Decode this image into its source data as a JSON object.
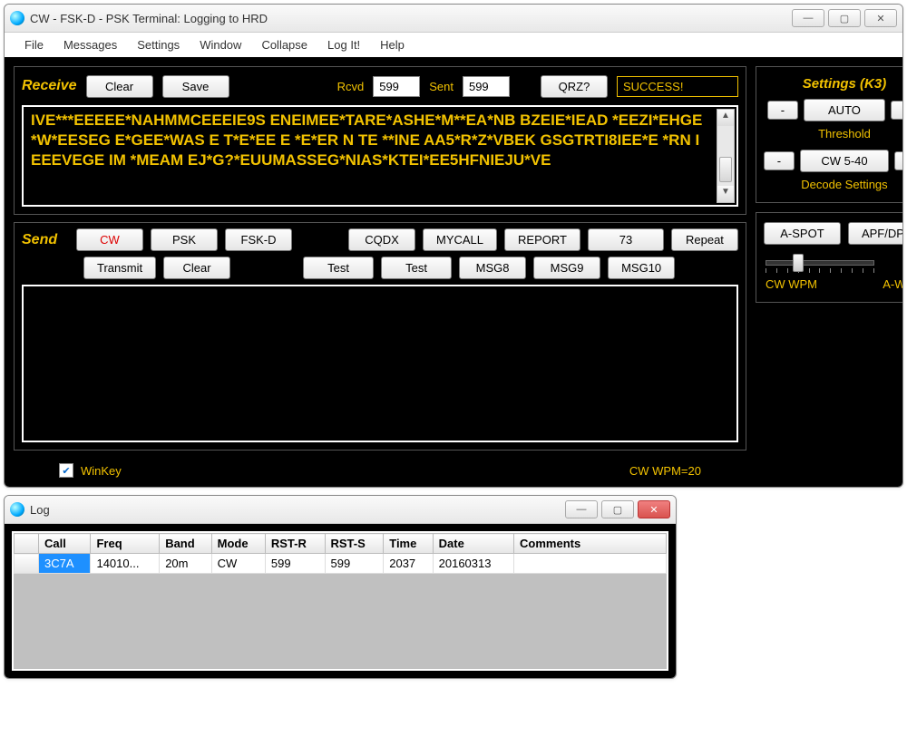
{
  "main": {
    "title": "CW - FSK-D - PSK Terminal: Logging to HRD",
    "menu": [
      "File",
      "Messages",
      "Settings",
      "Window",
      "Collapse",
      "Log It!",
      "Help"
    ],
    "receive": {
      "label": "Receive",
      "clear": "Clear",
      "save": "Save",
      "rcvd_label": "Rcvd",
      "rcvd_value": "599",
      "sent_label": "Sent",
      "sent_value": "599",
      "qrz": "QRZ?",
      "status": "SUCCESS!",
      "decoded_text": "IVE***EEEEE*NAHMMCEEEIE9S ENEIMEE*TARE*ASHE*M**EA*NB BZEIE*IEAD *EEZI*EHGE *W*EESEG E*GEE*WAS E T*E*EE E *E*ER N TE **INE AA5*R*Z*VBEK GSGTRTI8IEE*E *RN I EEEVEGE IM *MEAM EJ*G?*EUUMASSEG*NIAS*KTEI*EE5HFNIEJU*VE"
    },
    "send": {
      "label": "Send",
      "modes": {
        "cw": "CW",
        "psk": "PSK",
        "fskd": "FSK-D"
      },
      "msg_row1": [
        "CQDX",
        "MYCALL",
        "REPORT",
        "73",
        "Repeat"
      ],
      "row2": {
        "transmit": "Transmit",
        "clear": "Clear"
      },
      "msg_row2": [
        "Test",
        "Test",
        "MSG8",
        "MSG9",
        "MSG10"
      ]
    },
    "footer": {
      "winkey_label": "WinKey",
      "wpm_label": "CW WPM=20"
    },
    "settings": {
      "title": "Settings (K3)",
      "threshold": {
        "minus": "-",
        "value": "AUTO",
        "plus": "+",
        "label": "Threshold"
      },
      "decode": {
        "minus": "-",
        "value": "CW 5-40",
        "plus": "+",
        "label": "Decode Settings"
      }
    },
    "controls": {
      "aspot": "A-SPOT",
      "apf": "APF/DPB",
      "cwwpm_label": "CW WPM",
      "awpm_label": "A-WPM"
    }
  },
  "log": {
    "title": "Log",
    "columns": [
      "",
      "Call",
      "Freq",
      "Band",
      "Mode",
      "RST-R",
      "RST-S",
      "Time",
      "Date",
      "Comments"
    ],
    "rows": [
      {
        "call": "3C7A",
        "freq": "14010...",
        "band": "20m",
        "mode": "CW",
        "rstr": "599",
        "rsts": "599",
        "time": "2037",
        "date": "20160313",
        "comments": ""
      }
    ]
  }
}
